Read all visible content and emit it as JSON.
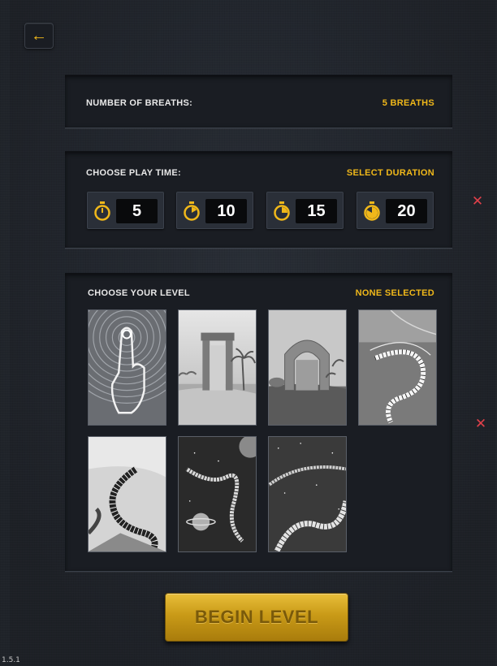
{
  "header": {
    "back_icon": "arrow-left-icon",
    "back_symbol": "←"
  },
  "breaths": {
    "label": "NUMBER OF BREATHS:",
    "value": "5 BREATHS"
  },
  "play_time": {
    "label": "CHOOSE PLAY TIME:",
    "action": "SELECT DURATION",
    "options": [
      {
        "value": "5",
        "icon": "stopwatch-icon"
      },
      {
        "value": "10",
        "icon": "stopwatch-icon"
      },
      {
        "value": "15",
        "icon": "stopwatch-icon"
      },
      {
        "value": "20",
        "icon": "stopwatch-icon"
      }
    ],
    "close_symbol": "✕"
  },
  "levels": {
    "label": "CHOOSE YOUR LEVEL",
    "status": "NONE SELECTED",
    "items": [
      {
        "name": "touch-finger"
      },
      {
        "name": "desert-gate"
      },
      {
        "name": "stone-arch"
      },
      {
        "name": "spiral-stairs-ocean"
      },
      {
        "name": "spiral-stairs-sky"
      },
      {
        "name": "space-stairs-planet"
      },
      {
        "name": "space-stairs-stars"
      }
    ],
    "close_symbol": "✕"
  },
  "begin_button": {
    "label": "BEGIN LEVEL"
  },
  "version": "1.5.1",
  "colors": {
    "accent": "#f0b81a",
    "close": "#e0404a",
    "panel": "#1a1d23",
    "background": "#24282f"
  }
}
